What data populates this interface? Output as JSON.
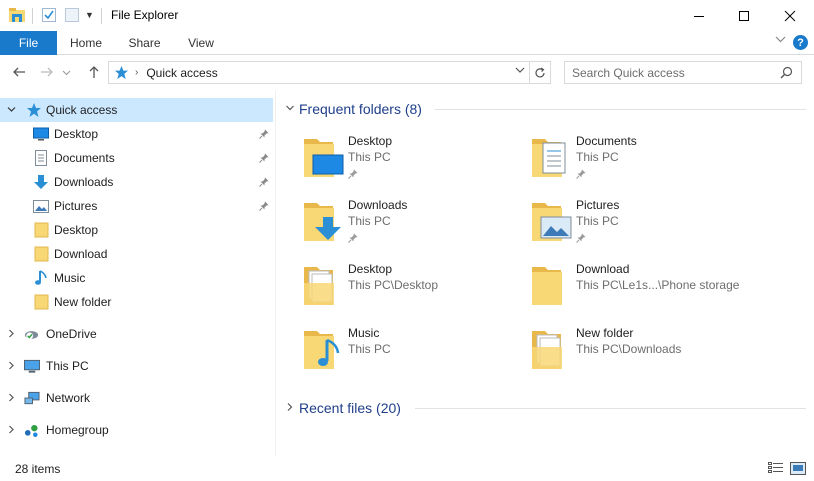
{
  "window": {
    "title": "File Explorer",
    "minimize": "—",
    "maximize": "☐",
    "close": "✕"
  },
  "ribbon": {
    "tabs": [
      "File",
      "Home",
      "Share",
      "View"
    ],
    "help": "?"
  },
  "address": {
    "path": "Quick access",
    "search_placeholder": "Search Quick access"
  },
  "nav": {
    "quick_access": "Quick access",
    "quick_items": [
      {
        "label": "Desktop",
        "icon": "desktop-icon",
        "pinned": true
      },
      {
        "label": "Documents",
        "icon": "documents-icon",
        "pinned": true
      },
      {
        "label": "Downloads",
        "icon": "downloads-icon",
        "pinned": true
      },
      {
        "label": "Pictures",
        "icon": "pictures-icon",
        "pinned": true
      },
      {
        "label": "Desktop",
        "icon": "folder-icon",
        "pinned": false
      },
      {
        "label": "Download",
        "icon": "folder-icon",
        "pinned": false
      },
      {
        "label": "Music",
        "icon": "music-icon",
        "pinned": false
      },
      {
        "label": "New folder",
        "icon": "folder-icon",
        "pinned": false
      }
    ],
    "roots": [
      {
        "label": "OneDrive",
        "icon": "onedrive-icon"
      },
      {
        "label": "This PC",
        "icon": "this-pc-icon"
      },
      {
        "label": "Network",
        "icon": "network-icon"
      },
      {
        "label": "Homegroup",
        "icon": "homegroup-icon"
      }
    ]
  },
  "content": {
    "frequent_header": "Frequent folders (8)",
    "recent_header": "Recent files (20)",
    "folders": [
      {
        "name": "Desktop",
        "path": "This PC",
        "pinned": true,
        "icon": "desktop-folder-icon"
      },
      {
        "name": "Documents",
        "path": "This PC",
        "pinned": true,
        "icon": "documents-folder-icon"
      },
      {
        "name": "Downloads",
        "path": "This PC",
        "pinned": true,
        "icon": "downloads-folder-icon"
      },
      {
        "name": "Pictures",
        "path": "This PC",
        "pinned": true,
        "icon": "pictures-folder-icon"
      },
      {
        "name": "Desktop",
        "path": "This PC\\Desktop",
        "pinned": false,
        "icon": "folder-with-files-icon"
      },
      {
        "name": "Download",
        "path": "This PC\\Le1s...\\Phone storage",
        "pinned": false,
        "icon": "plain-folder-icon"
      },
      {
        "name": "Music",
        "path": "This PC",
        "pinned": false,
        "icon": "music-folder-icon"
      },
      {
        "name": "New folder",
        "path": "This PC\\Downloads",
        "pinned": false,
        "icon": "folder-with-files-icon"
      }
    ]
  },
  "status": {
    "items_count": "28 items"
  },
  "colors": {
    "accent": "#1979ca",
    "selection": "#cce8ff",
    "folder": "#f8d775",
    "header_text": "#1f3f8a"
  }
}
